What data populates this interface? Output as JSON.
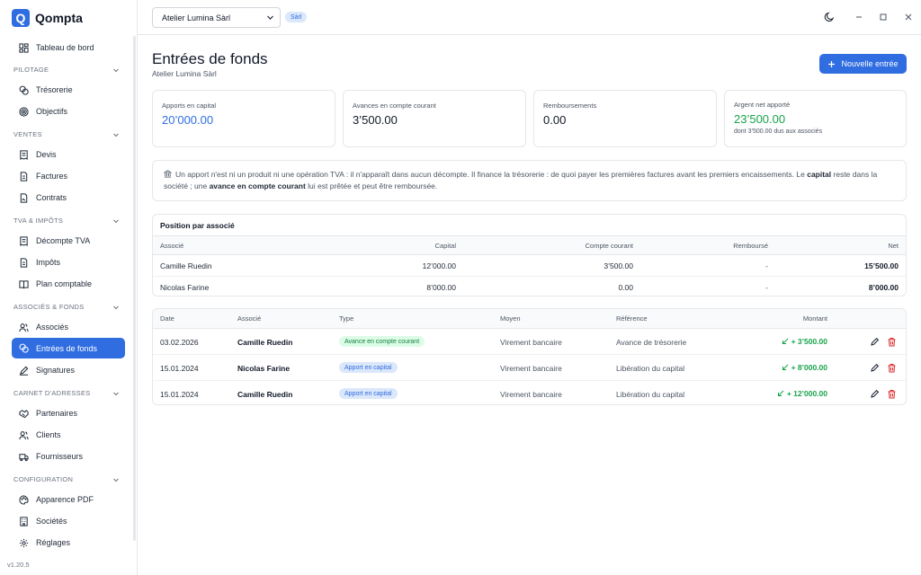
{
  "app": {
    "name": "Qompta",
    "logo_letter": "Q",
    "version": "v1.20.5"
  },
  "sidebar": {
    "dashboard": "Tableau de bord",
    "sections": [
      {
        "label": "PILOTAGE",
        "items": [
          "Trésorerie",
          "Objectifs"
        ]
      },
      {
        "label": "VENTES",
        "items": [
          "Devis",
          "Factures",
          "Contrats"
        ]
      },
      {
        "label": "TVA & IMPÔTS",
        "items": [
          "Décompte TVA",
          "Impôts",
          "Plan comptable"
        ]
      },
      {
        "label": "ASSOCIÉS & FONDS",
        "items": [
          "Associés",
          "Entrées de fonds",
          "Signatures"
        ]
      },
      {
        "label": "CARNET D'ADRESSES",
        "items": [
          "Partenaires",
          "Clients",
          "Fournisseurs"
        ]
      },
      {
        "label": "CONFIGURATION",
        "items": [
          "Apparence PDF",
          "Sociétés",
          "Réglages"
        ]
      }
    ],
    "active_item": "Entrées de fonds"
  },
  "topbar": {
    "company": "Atelier Lumina Sàrl",
    "legal_form": "Sàrl"
  },
  "page": {
    "title": "Entrées de fonds",
    "subtitle": "Atelier Lumina Sàrl",
    "new_button": "Nouvelle entrée"
  },
  "stats": [
    {
      "label": "Apports en capital",
      "value": "20’000.00",
      "color": "blue"
    },
    {
      "label": "Avances en compte courant",
      "value": "3’500.00",
      "color": "default"
    },
    {
      "label": "Remboursements",
      "value": "0.00",
      "color": "default"
    },
    {
      "label": "Argent net apporté",
      "value": "23’500.00",
      "color": "green",
      "note": "dont 3’500.00 dus aux associés"
    }
  ],
  "info": {
    "part1": "Un apport n'est ni un produit ni une opération TVA : il n'apparaît dans aucun décompte. Il finance la trésorerie : de quoi payer les premières factures avant les premiers encaissements. Le ",
    "bold1": "capital",
    "part2": " reste dans la société ; une ",
    "bold2": "avance en compte courant",
    "part3": " lui est prêtée et peut être remboursée."
  },
  "positions": {
    "title": "Position par associé",
    "columns": {
      "partner": "Associé",
      "capital": "Capital",
      "current": "Compte courant",
      "repaid": "Remboursé",
      "net": "Net"
    },
    "rows": [
      {
        "partner": "Camille Ruedin",
        "capital": "12’000.00",
        "current": "3’500.00",
        "repaid": "-",
        "net": "15’500.00"
      },
      {
        "partner": "Nicolas Farine",
        "capital": "8’000.00",
        "current": "0.00",
        "repaid": "-",
        "net": "8’000.00"
      }
    ]
  },
  "entries": {
    "columns": {
      "date": "Date",
      "partner": "Associé",
      "type": "Type",
      "method": "Moyen",
      "reference": "Référence",
      "amount": "Montant"
    },
    "rows": [
      {
        "date": "03.02.2026",
        "partner": "Camille Ruedin",
        "type": "Avance en compte courant",
        "type_color": "green",
        "method": "Virement bancaire",
        "reference": "Avance de trésorerie",
        "amount": "+ 3’500.00"
      },
      {
        "date": "15.01.2024",
        "partner": "Nicolas Farine",
        "type": "Apport en capital",
        "type_color": "blue",
        "method": "Virement bancaire",
        "reference": "Libération du capital",
        "amount": "+ 8’000.00"
      },
      {
        "date": "15.01.2024",
        "partner": "Camille Ruedin",
        "type": "Apport en capital",
        "type_color": "blue",
        "method": "Virement bancaire",
        "reference": "Libération du capital",
        "amount": "+ 12’000.00"
      }
    ]
  },
  "colors": {
    "accent": "#2f6de1",
    "positive": "#16a34a",
    "danger": "#dc2626"
  }
}
